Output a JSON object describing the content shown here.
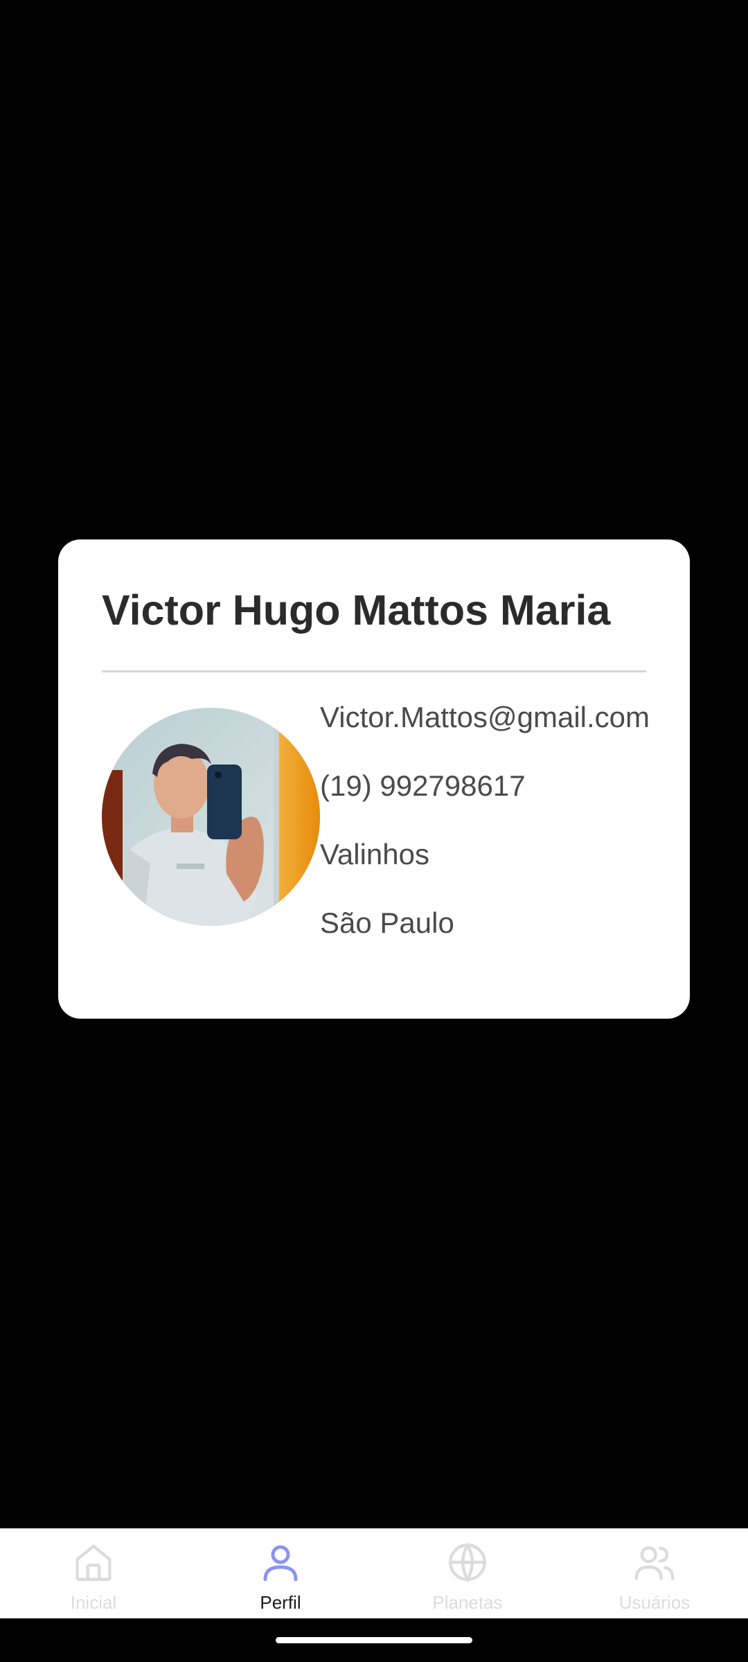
{
  "profile": {
    "name": "Victor Hugo Mattos Maria",
    "email": "Victor.Mattos@gmail.com",
    "phone": "(19) 992798617",
    "city": "Valinhos",
    "state": "São Paulo",
    "photo_icon": "user-photo"
  },
  "nav": {
    "items": [
      {
        "label": "Inicial",
        "icon": "home-icon",
        "active": false
      },
      {
        "label": "Perfil",
        "icon": "user-icon",
        "active": true
      },
      {
        "label": "Planetas",
        "icon": "globe-icon",
        "active": false
      },
      {
        "label": "Usuários",
        "icon": "users-icon",
        "active": false
      }
    ],
    "active_color": "#8A93F4",
    "inactive_color": "#DCDCDC"
  },
  "colors": {
    "background": "#000000",
    "card": "#FFFFFF"
  }
}
